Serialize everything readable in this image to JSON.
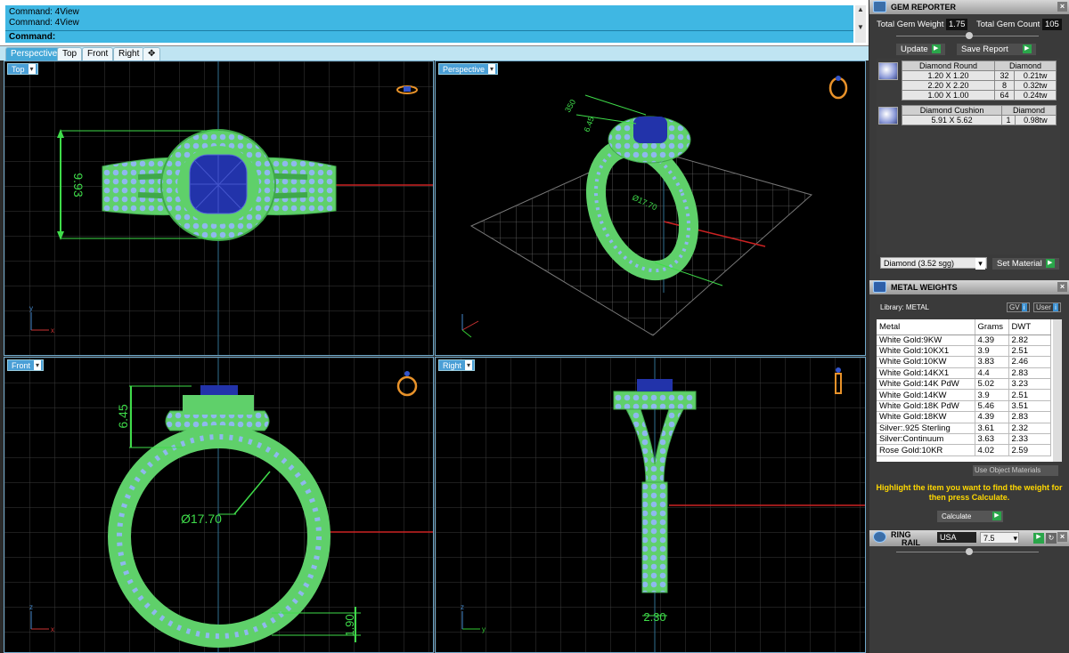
{
  "command": {
    "history": [
      "Command: 4View",
      "Command: 4View"
    ],
    "prompt": "Command:"
  },
  "tabs": [
    "Perspective",
    "Top",
    "Front",
    "Right",
    "✥"
  ],
  "viewports": {
    "top": {
      "label": "Top",
      "dimension": "9.93",
      "axis_x": "x",
      "axis_y": "y"
    },
    "perspective": {
      "label": "Perspective",
      "dim_a": "350",
      "dim_b": "6.45",
      "diameter": "Ø17.70"
    },
    "front": {
      "label": "Front",
      "height": "6.45",
      "diameter": "Ø17.70",
      "band": "1.90",
      "axis_x": "x",
      "axis_z": "z"
    },
    "right": {
      "label": "Right",
      "width": "2.30",
      "axis_y": "y",
      "axis_z": "z"
    }
  },
  "gem_reporter": {
    "title": "GEM REPORTER",
    "total_weight_label": "Total Gem Weight",
    "total_weight": "1.75",
    "total_count_label": "Total Gem Count",
    "total_count": "105",
    "update_label": "Update",
    "save_label": "Save Report",
    "groups": [
      {
        "shape": "Diamond Round",
        "material": "Diamond",
        "rows": [
          {
            "size": "1.20 X 1.20",
            "count": "32",
            "weight": "0.21tw"
          },
          {
            "size": "2.20 X 2.20",
            "count": "8",
            "weight": "0.32tw"
          },
          {
            "size": "1.00 X 1.00",
            "count": "64",
            "weight": "0.24tw"
          }
        ]
      },
      {
        "shape": "Diamond Cushion",
        "material": "Diamond",
        "rows": [
          {
            "size": "5.91 X 5.62",
            "count": "1",
            "weight": "0.98tw"
          }
        ]
      }
    ],
    "material_select": "Diamond     (3.52 sgg)",
    "set_material_label": "Set Material"
  },
  "metal_weights": {
    "title": "METAL WEIGHTS",
    "library_label": "Library: METAL",
    "gv_label": "GV",
    "user_label": "User",
    "columns": [
      "Metal",
      "Grams",
      "DWT"
    ],
    "rows": [
      [
        "White Gold:9KW",
        "4.39",
        "2.82"
      ],
      [
        "White Gold:10KX1",
        "3.9",
        "2.51"
      ],
      [
        "White Gold:10KW",
        "3.83",
        "2.46"
      ],
      [
        "White Gold:14KX1",
        "4.4",
        "2.83"
      ],
      [
        "White Gold:14K PdW",
        "5.02",
        "3.23"
      ],
      [
        "White Gold:14KW",
        "3.9",
        "2.51"
      ],
      [
        "White Gold:18K PdW",
        "5.46",
        "3.51"
      ],
      [
        "White Gold:18KW",
        "4.39",
        "2.83"
      ],
      [
        "Silver:.925 Sterling",
        "3.61",
        "2.32"
      ],
      [
        "Silver:Continuum",
        "3.63",
        "2.33"
      ],
      [
        "Rose Gold:10KR",
        "4.02",
        "2.59"
      ]
    ],
    "use_object_label": "Use Object Materials",
    "hint": "Highlight the item you want to find the weight for then press Calculate.",
    "calculate_label": "Calculate"
  },
  "ring_rail": {
    "title_line1": "RING",
    "title_line2": "RAIL",
    "region": "USA",
    "size": "7.5"
  }
}
